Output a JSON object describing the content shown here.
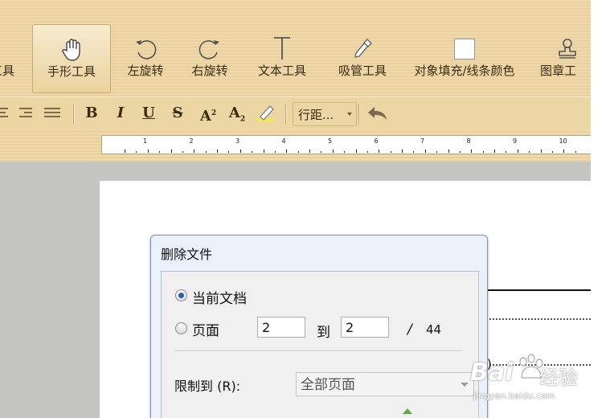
{
  "toolbar": {
    "tools": [
      {
        "label": "工具",
        "icon": "tool-icon"
      },
      {
        "label": "手形工具",
        "icon": "hand-icon"
      },
      {
        "label": "左旋转",
        "icon": "rotate-left-icon"
      },
      {
        "label": "右旋转",
        "icon": "rotate-right-icon"
      },
      {
        "label": "文本工具",
        "icon": "text-icon"
      },
      {
        "label": "吸管工具",
        "icon": "eyedropper-icon"
      },
      {
        "label": "对象填充/线条颜色",
        "icon": "fill-color-icon"
      },
      {
        "label": "图章工",
        "icon": "stamp-icon"
      }
    ]
  },
  "format": {
    "bold": "B",
    "italic": "I",
    "underline": "U",
    "strike": "S",
    "superscript": "A",
    "superscript_mark": "2",
    "subscript": "A",
    "subscript_mark": "2",
    "line_spacing": "行距..."
  },
  "ruler": {
    "numbers": [
      "1",
      "2",
      "3",
      "4",
      "5",
      "6",
      "7",
      "8",
      "9",
      "10"
    ]
  },
  "dialog": {
    "title": "删除文件",
    "option_current": "当前文档",
    "option_pages": "页面",
    "from_page": "2",
    "to_label": "到",
    "to_page": "2",
    "slash": "/",
    "total_pages": "44",
    "limit_label": "限制到 (R):",
    "limit_value": "全部页面"
  },
  "watermark": {
    "brand": "Bai",
    "brand2": "经验",
    "url": "jingyan.baidu.com"
  },
  "colors": {
    "ribbon": "#efd9aa",
    "accent": "#2d5fa8",
    "workspace": "#c5c5c2"
  }
}
